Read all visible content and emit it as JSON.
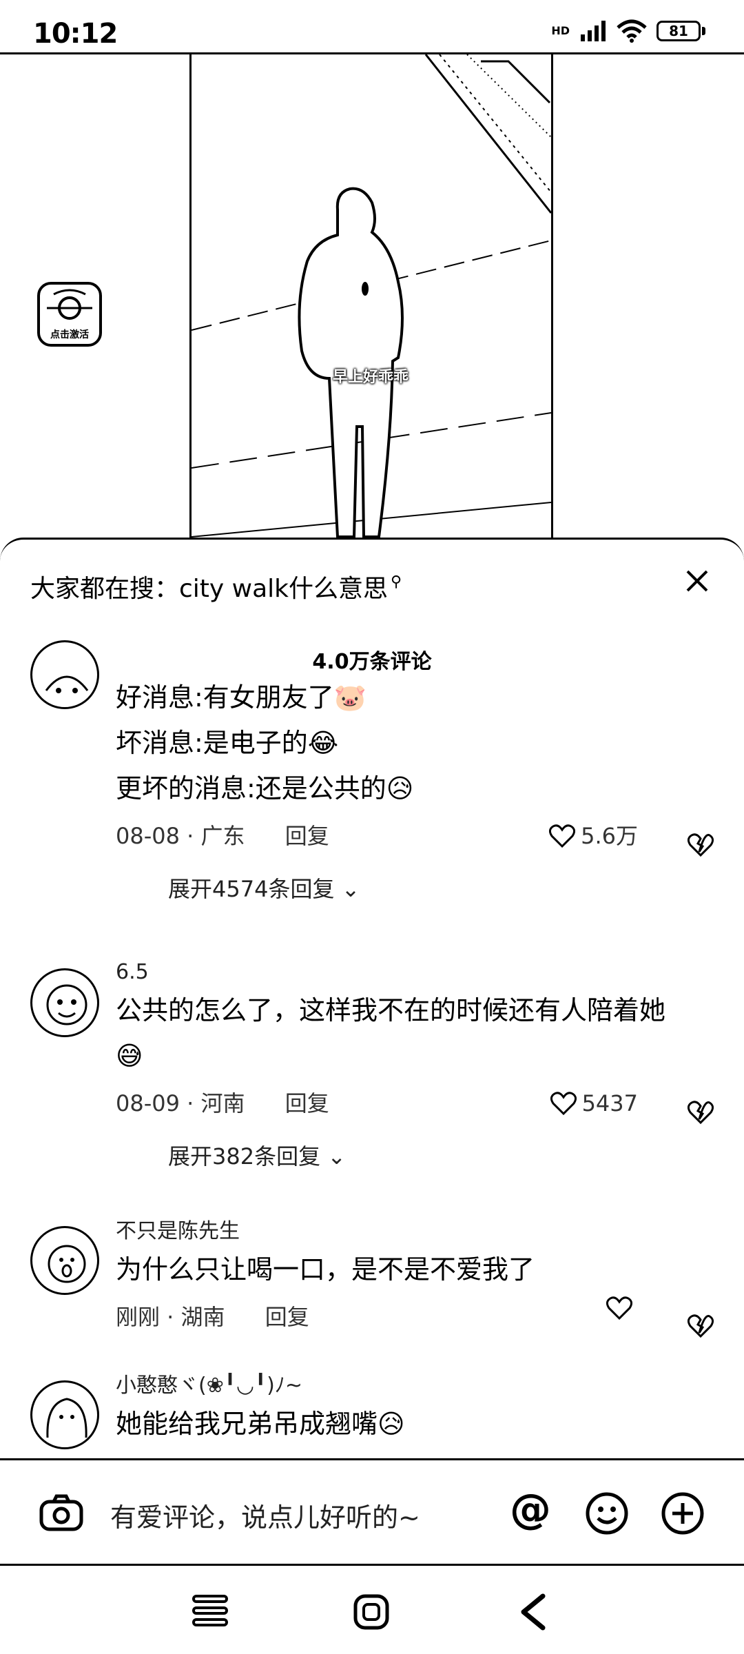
{
  "status_bar": {
    "time": "10:12",
    "network": "HD",
    "battery": "81"
  },
  "video": {
    "caption": "早上好乖乖",
    "activate_label": "点击激活"
  },
  "comments_panel": {
    "search_hint": "大家都在搜：city walk什么意思",
    "comment_count": "4.0万条评论",
    "comments": [
      {
        "username": "",
        "lines": [
          "好消息:有女朋友了🐷",
          "坏消息:是电子的😂",
          "更坏的消息:还是公共的😥"
        ],
        "date_location": "08-08 · 广东",
        "reply_label": "回复",
        "likes": "5.6万",
        "expand": "展开4574条回复"
      },
      {
        "username": "6.5",
        "lines": [
          "公共的怎么了，这样我不在的时候还有人陪着她",
          "😅"
        ],
        "date_location": "08-09 · 河南",
        "reply_label": "回复",
        "likes": "5437",
        "expand": "展开382条回复"
      },
      {
        "username": "不只是陈先生",
        "lines": [
          "为什么只让喝一口，是不是不爱我了"
        ],
        "date_location": "刚刚 · 湖南",
        "reply_label": "回复",
        "likes": ""
      },
      {
        "username": "小憨憨ヾ(❀╹◡╹)ﾉ~",
        "lines": [
          "她能给我兄弟吊成翘嘴😥"
        ]
      }
    ]
  },
  "input_bar": {
    "placeholder": "有爱评论，说点儿好听的~",
    "at_symbol": "@"
  }
}
